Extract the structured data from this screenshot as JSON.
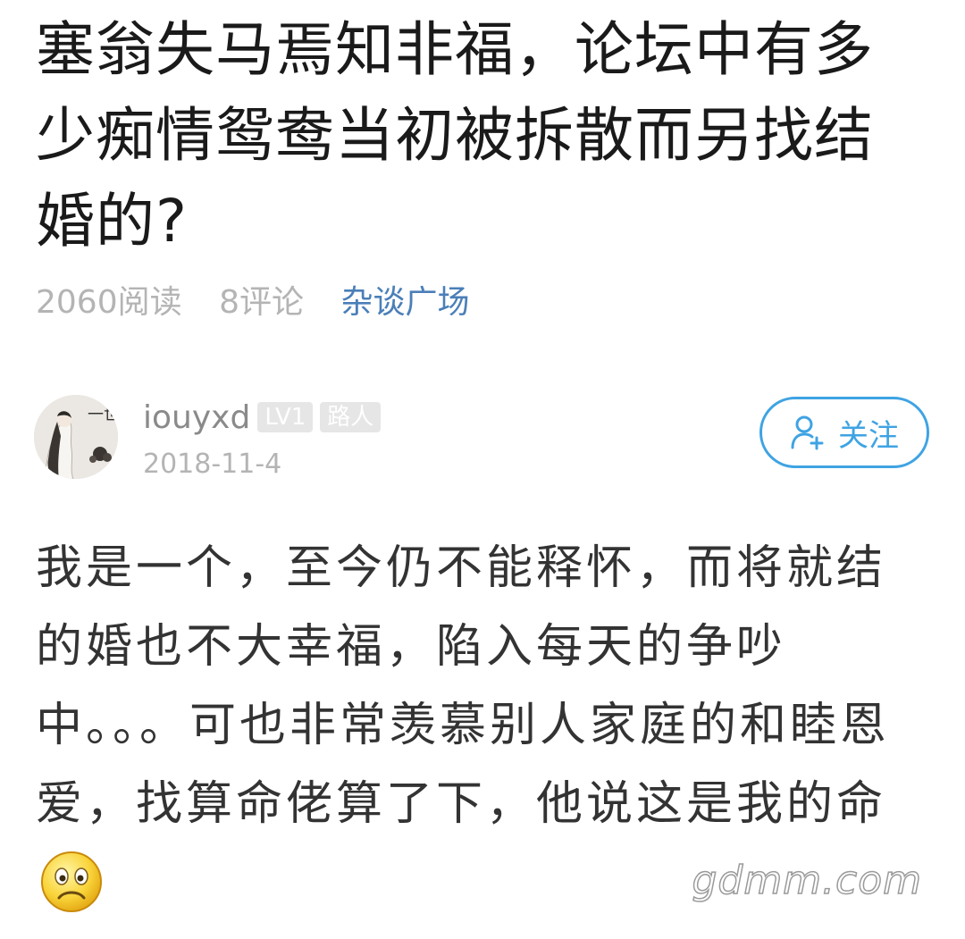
{
  "post": {
    "title": "塞翁失马焉知非福，论坛中有多少痴情鸳鸯当初被拆散而另找结婚的?",
    "reads": "2060阅读",
    "comments": "8评论",
    "category": "杂谈广场"
  },
  "author": {
    "username": "iouyxd",
    "level": "LV1",
    "rank": "路人",
    "date": "2018-11-4",
    "avatar_text": "一世书伤",
    "follow_label": "关注"
  },
  "content": {
    "body": "我是一个，至今仍不能释怀，而将就结的婚也不大幸福，陷入每天的争吵中。。。可也非常羡慕别人家庭的和睦恩爱，找算命佬算了下，他说这是我的命",
    "emoji": "frowning-face-icon"
  },
  "watermark": "gdmm.com",
  "colors": {
    "accent": "#3fa3e3",
    "category": "#4a7fb8",
    "muted": "#b4b4b4"
  }
}
